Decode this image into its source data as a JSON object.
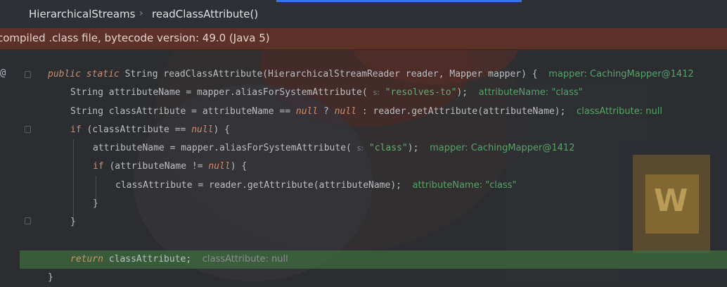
{
  "breadcrumb": {
    "items": [
      "HierarchicalStreams",
      "readClassAttribute()"
    ],
    "separator": "›"
  },
  "banner": {
    "text": "compiled .class file, bytecode version: 49.0 (Java 5)"
  },
  "gutter": {
    "marker": "@"
  },
  "code": {
    "l1": {
      "kw1": "public",
      "kw2": "static",
      "type": "String",
      "text": " readClassAttribute(HierarchicalStreamReader reader, Mapper mapper) {",
      "debug": "mapper: CachingMapper@1412"
    },
    "l2": {
      "pre": "String attributeName = mapper.aliasForSystemAttribute(",
      "hint": "s:",
      "str": "\"resolves-to\"",
      "post": ");",
      "debug": "attributeName: \"class\""
    },
    "l3": {
      "pre": "String classAttribute = attributeName == ",
      "null1": "null",
      "q": " ? ",
      "null2": "null",
      "post": " : reader.getAttribute(attributeName);",
      "debug": "classAttribute: null"
    },
    "l4": {
      "kw": "if",
      "pre": " (classAttribute == ",
      "null": "null",
      "post": ") {"
    },
    "l5": {
      "pre": "attributeName = mapper.aliasForSystemAttribute(",
      "hint": "s:",
      "str": "\"class\"",
      "post": ");",
      "debug": "mapper: CachingMapper@1412"
    },
    "l6": {
      "kw": "if",
      "pre": " (attributeName != ",
      "null": "null",
      "post": ") {"
    },
    "l7": {
      "text": "classAttribute = reader.getAttribute(attributeName);",
      "debug": "attributeName: \"class\""
    },
    "l8": {
      "text": "}"
    },
    "l9": {
      "text": "}"
    },
    "l10": {
      "kw": "return",
      "text": " classAttribute;",
      "debug": "classAttribute: null"
    },
    "l11": {
      "text": "}"
    }
  }
}
